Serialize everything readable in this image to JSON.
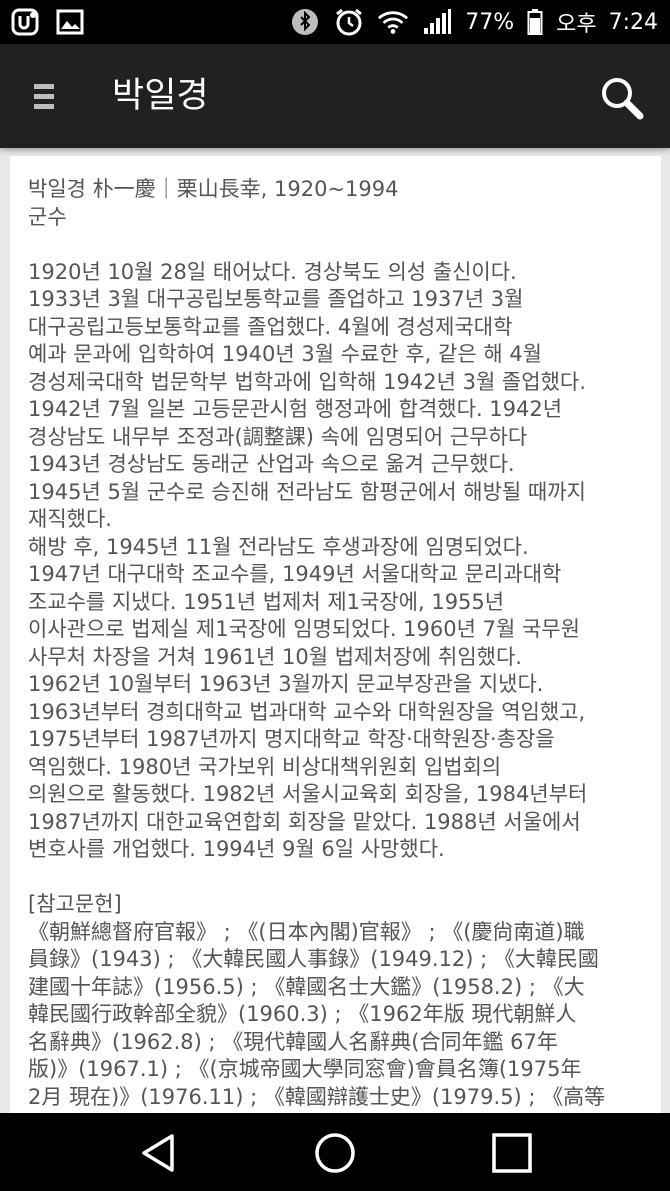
{
  "status_bar": {
    "battery_percent": "77%",
    "time_period": "오후",
    "time": "7:24",
    "icons": [
      "u-plus-icon",
      "gallery-icon",
      "bluetooth-icon",
      "alarm-icon",
      "wifi-icon",
      "signal-icon",
      "battery-icon"
    ]
  },
  "app_bar": {
    "title": "박일경",
    "menu_icon": "hamburger-menu-icon",
    "search_icon": "search-icon"
  },
  "article": {
    "header_lines": [
      "박일경 朴一慶｜栗山長幸, 1920~1994",
      "군수"
    ],
    "body_lines": [
      "1920년 10월 28일 태어났다. 경상북도 의성 출신이다.",
      "1933년 3월 대구공립보통학교를 졸업하고 1937년 3월",
      "대구공립고등보통학교를 졸업했다. 4월에 경성제국대학",
      "예과 문과에 입학하여 1940년 3월 수료한 후, 같은 해 4월",
      "경성제국대학 법문학부 법학과에 입학해 1942년 3월 졸업했다.",
      "1942년 7월 일본 고등문관시험 행정과에 합격했다. 1942년",
      "경상남도 내무부 조정과(調整課) 속에 임명되어 근무하다",
      "1943년 경상남도 동래군 산업과 속으로 옮겨 근무했다.",
      "1945년 5월 군수로 승진해 전라남도 함평군에서 해방될 때까지",
      "재직했다.",
      "해방 후, 1945년 11월 전라남도 후생과장에 임명되었다.",
      "1947년 대구대학 조교수를, 1949년 서울대학교 문리과대학",
      "조교수를 지냈다. 1951년 법제처 제1국장에, 1955년",
      "이사관으로 법제실 제1국장에 임명되었다. 1960년 7월 국무원",
      "사무처 차장을 거쳐 1961년 10월 법제처장에 취임했다.",
      "1962년 10월부터 1963년 3월까지 문교부장관을 지냈다.",
      "1963년부터 경희대학교 법과대학 교수와 대학원장을 역임했고,",
      "1975년부터 1987년까지 명지대학교 학장·대학원장·총장을",
      "역임했다. 1980년 국가보위 비상대책위원회 입법회의",
      "의원으로 활동했다. 1982년 서울시교육회 회장을, 1984년부터",
      "1987년까지 대한교육연합회 회장을 맡았다. 1988년 서울에서",
      "변호사를 개업했다. 1994년 9월 6일 사망했다."
    ],
    "references_heading": "[참고문헌]",
    "reference_lines": [
      "《朝鮮總督府官報》 ; 《(日本內閣)官報》 ; 《(慶尙南道)職",
      "員錄》(1943) ; 《大韓民國人事錄》(1949.12) ; 《大韓民國",
      "建國十年誌》(1956.5) ; 《韓國名士大鑑》(1958.2) ; 《大",
      "韓民國行政幹部全貌》(1960.3) ; 《1962年版 現代朝鮮人",
      "名辭典》(1962.8) ; 《現代韓國人名辭典(合同年鑑 67年",
      "版)》(1967.1) ; 《(京城帝國大學同窓會)會員名簿(1975年",
      "2月 現在)》(1976.11) ; 《韓國辯護士史》(1979.5) ; 《高等"
    ]
  },
  "nav_bar": {
    "back_icon": "back-triangle-icon",
    "home_icon": "home-circle-icon",
    "recents_icon": "recents-square-icon"
  }
}
